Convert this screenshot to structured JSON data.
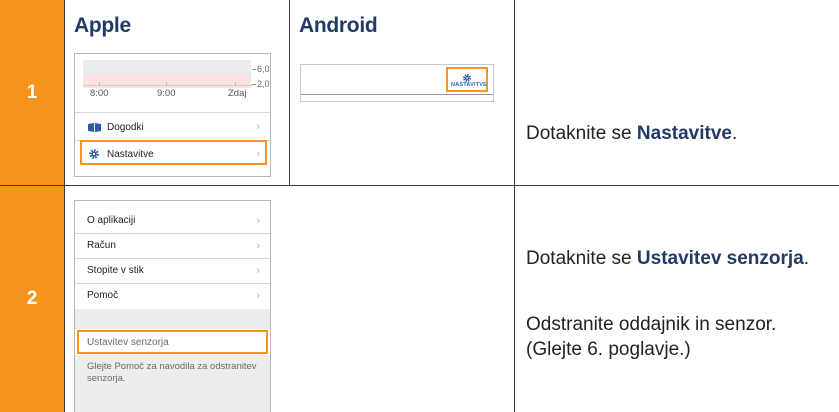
{
  "columns": {
    "apple": "Apple",
    "android": "Android"
  },
  "colors": {
    "accent": "#f7941d",
    "heading": "#223a66",
    "border": "#3a3a3a"
  },
  "steps": [
    {
      "number": "1",
      "apple": {
        "graph": {
          "y_labels": [
            "6,0",
            "2,0"
          ],
          "x_labels": [
            "8:00",
            "9:00",
            "Zdaj"
          ]
        },
        "menu": [
          {
            "label": "Dogodki",
            "icon": "book-icon"
          },
          {
            "label": "Nastavitve",
            "icon": "gear-icon",
            "highlighted": true
          }
        ]
      },
      "android": {
        "button_label": "NASTAVITVE",
        "icon": "gear-icon"
      },
      "instruction": {
        "prefix": "Dotaknite se ",
        "bold": "Nastavitve",
        "suffix": "."
      }
    },
    {
      "number": "2",
      "apple": {
        "menu": [
          "O aplikaciji",
          "Račun",
          "Stopite v stik",
          "Pomoč"
        ],
        "sensor_row": "Ustavitev senzorja",
        "info": "Glejte Pomoč za navodila za odstranitev senzorja."
      },
      "instruction": {
        "prefix": "Dotaknite se ",
        "bold": "Ustavitev senzorja",
        "suffix": ".",
        "line2": "Odstranite oddajnik in senzor. (Glejte 6. poglavje.)"
      }
    }
  ]
}
